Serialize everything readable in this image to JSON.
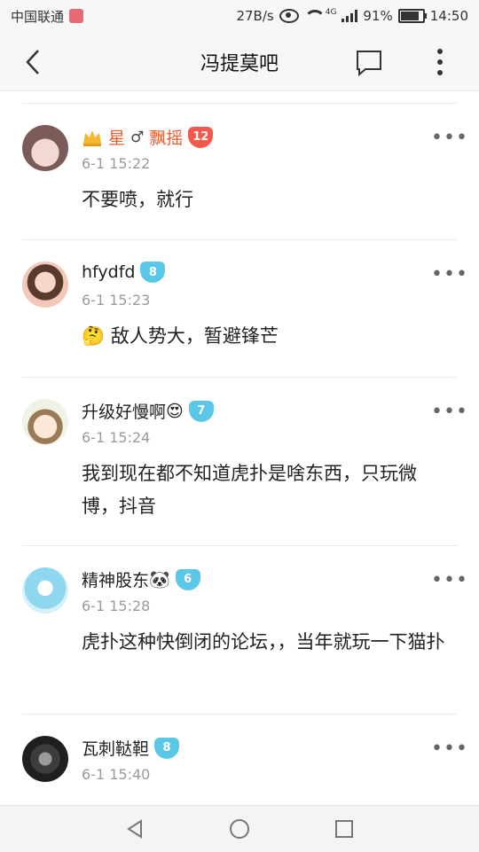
{
  "status_bar": {
    "carrier": "中国联通",
    "speed": "27B/s",
    "network": "4G",
    "battery": "91%",
    "time": "14:50"
  },
  "header": {
    "title": "冯提莫吧"
  },
  "posts": [
    {
      "name_part1": "星",
      "gender": "♂",
      "name_part2": "飘摇",
      "level": "12",
      "time": "6-1 15:22",
      "content": "不要喷，就行"
    },
    {
      "name": "hfydfd",
      "level": "8",
      "time": "6-1 15:23",
      "emoji": "🤔",
      "content": "敌人势大，暂避锋芒"
    },
    {
      "name": "升级好慢啊",
      "emoji": "😍",
      "level": "7",
      "time": "6-1 15:24",
      "content": "我到现在都不知道虎扑是啥东西，只玩微博，抖音"
    },
    {
      "name": "精神股东",
      "emoji": "🐼",
      "level": "6",
      "time": "6-1 15:28",
      "content": "虎扑这种快倒闭的论坛，，当年就玩一下猫扑"
    },
    {
      "name": "瓦刺鞑靼",
      "level": "8",
      "time": "6-1 15:40"
    }
  ],
  "colors": {
    "vip_name": "#ef5a2a",
    "level_blue": "#5bc7e6",
    "level_red": "#f35a4c"
  }
}
